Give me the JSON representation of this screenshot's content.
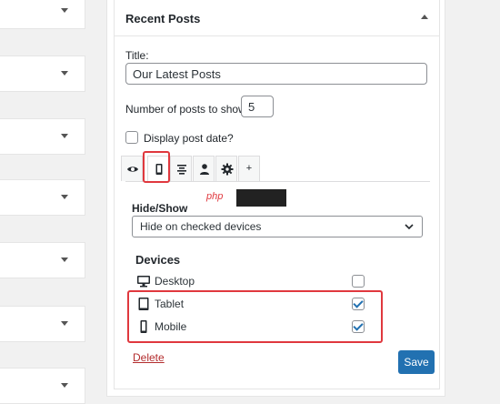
{
  "widget": {
    "title": "Recent Posts",
    "title_label": "Title:",
    "title_value": "Our Latest Posts",
    "posts_label": "Number of posts to show:",
    "posts_value": "5",
    "date_label": "Display post date?",
    "date_checked": false
  },
  "tabs": [
    {
      "name": "visibility",
      "icon": "eye-icon"
    },
    {
      "name": "devices",
      "icon": "mobile-icon",
      "active": true
    },
    {
      "name": "alignment",
      "icon": "align-center-icon"
    },
    {
      "name": "user-roles",
      "icon": "user-icon"
    },
    {
      "name": "settings",
      "icon": "gear-icon"
    },
    {
      "name": "more",
      "icon": "plus-icon",
      "label": "+"
    }
  ],
  "panel": {
    "hide_show_label": "Hide/Show",
    "hide_show_value": "Hide on checked devices",
    "devices_label": "Devices",
    "devices": [
      {
        "label": "Desktop",
        "icon": "desktop-icon",
        "checked": false
      },
      {
        "label": "Tablet",
        "icon": "tablet-icon",
        "checked": true
      },
      {
        "label": "Mobile",
        "icon": "mobile-icon",
        "checked": true
      }
    ]
  },
  "footer": {
    "delete_label": "Delete",
    "save_label": "Save"
  },
  "watermark": {
    "text": "php"
  },
  "colors": {
    "accent": "#2271b1",
    "highlight": "#e0383e",
    "delete": "#b32d2e"
  }
}
